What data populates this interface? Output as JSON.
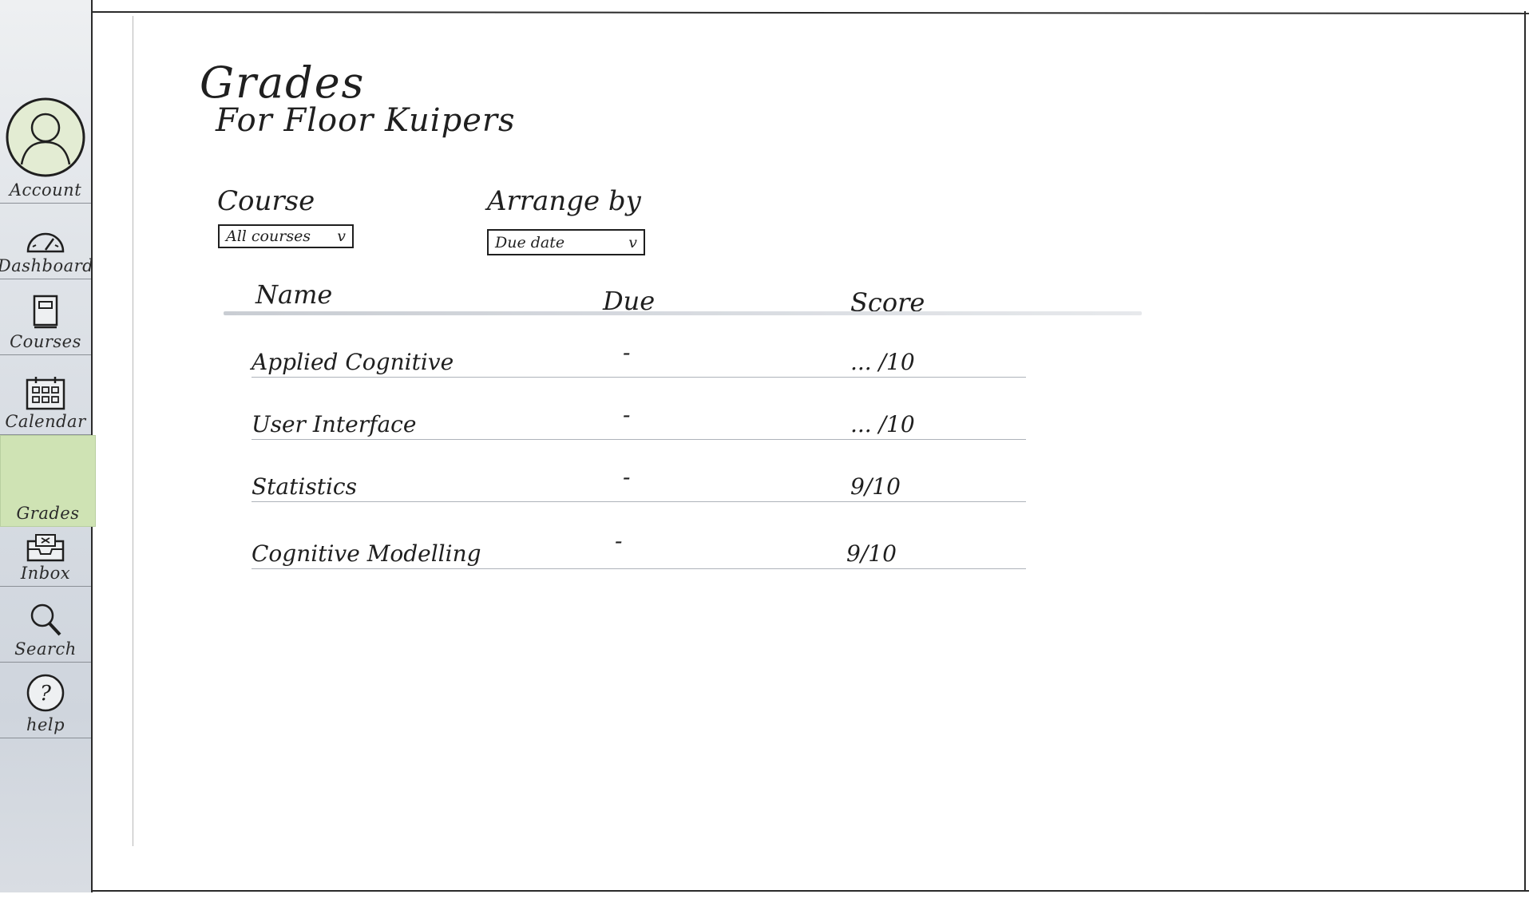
{
  "sidebar": {
    "items": [
      {
        "label": "Account",
        "icon": "user-avatar-icon"
      },
      {
        "label": "Dashboard",
        "icon": "speedometer-icon"
      },
      {
        "label": "Courses",
        "icon": "book-icon"
      },
      {
        "label": "Calendar",
        "icon": "calendar-icon"
      },
      {
        "label": "Grades",
        "icon": "none"
      },
      {
        "label": "Inbox",
        "icon": "inbox-icon"
      },
      {
        "label": "Search",
        "icon": "search-icon"
      },
      {
        "label": "help",
        "icon": "help-icon"
      }
    ],
    "active_item": "Grades",
    "active_color": "#cfe3b4"
  },
  "page": {
    "title": "Grades",
    "subtitle": "For Floor Kuipers"
  },
  "filters": {
    "course_label": "Course",
    "course_value": "All courses",
    "arrange_label": "Arrange by",
    "arrange_value": "Due date",
    "chevron": "v"
  },
  "table": {
    "columns": [
      "Name",
      "Due",
      "Score"
    ],
    "rows": [
      {
        "name": "Applied Cognitive",
        "due": "-",
        "score": "... /10"
      },
      {
        "name": "User Interface",
        "due": "-",
        "score": "... /10"
      },
      {
        "name": "Statistics",
        "due": "-",
        "score": "9/10"
      },
      {
        "name": "Cognitive Modelling",
        "due": "-",
        "score": "9/10"
      }
    ]
  }
}
